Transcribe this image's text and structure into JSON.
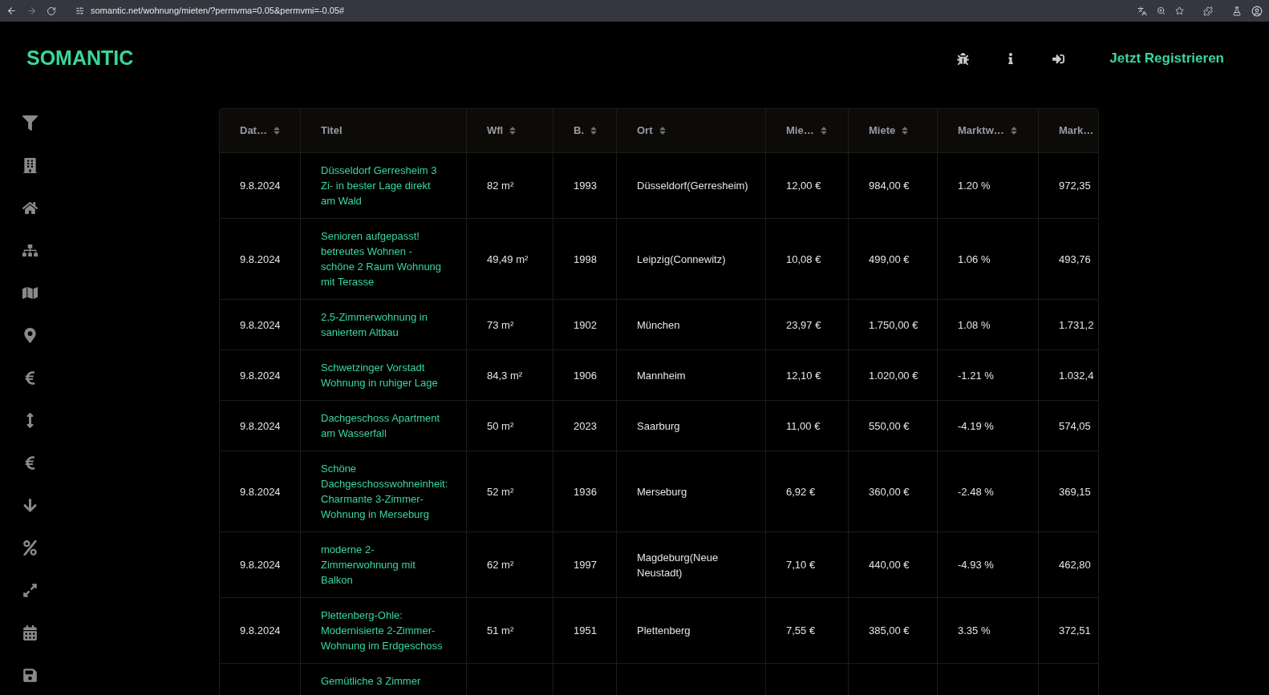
{
  "browser": {
    "url": "somantic.net/wohnung/mieten/?permvma=0.05&permvmi=-0.05#"
  },
  "header": {
    "logo": "SOMANTIC",
    "register": "Jetzt Registrieren"
  },
  "table": {
    "columns": [
      "Dat…",
      "Titel",
      "Wfl",
      "B.",
      "Ort",
      "Mie…",
      "Miete",
      "Marktw…",
      "Mark…"
    ],
    "rows": [
      {
        "date": "9.8.2024",
        "title": "Düsseldorf Gerresheim 3 Zi- in bester Lage direkt am Wald",
        "wfl": "82 m²",
        "year": "1993",
        "ort": "Düsseldorf(Gerresheim)",
        "sqm": "12,00 €",
        "rent": "984,00 €",
        "market": "1.20 %",
        "column_9": "972,35"
      },
      {
        "date": "9.8.2024",
        "title": "Senioren aufgepasst! betreutes Wohnen - schöne 2 Raum Wohnung mit Terasse",
        "wfl": "49,49 m²",
        "year": "1998",
        "ort": "Leipzig(Connewitz)",
        "sqm": "10,08 €",
        "rent": "499,00 €",
        "market": "1.06 %",
        "column_9": "493,76"
      },
      {
        "date": "9.8.2024",
        "title": "2,5-Zimmerwohnung in saniertem Altbau",
        "wfl": "73 m²",
        "year": "1902",
        "ort": "München",
        "sqm": "23,97 €",
        "rent": "1.750,00 €",
        "market": "1.08 %",
        "column_9": "1.731,2"
      },
      {
        "date": "9.8.2024",
        "title": "Schwetzinger Vorstadt Wohnung in ruhiger Lage",
        "wfl": "84,3 m²",
        "year": "1906",
        "ort": "Mannheim",
        "sqm": "12,10 €",
        "rent": "1.020,00 €",
        "market": "-1.21 %",
        "column_9": "1.032,4"
      },
      {
        "date": "9.8.2024",
        "title": "Dachgeschoss Apartment am Wasserfall",
        "wfl": "50 m²",
        "year": "2023",
        "ort": "Saarburg",
        "sqm": "11,00 €",
        "rent": "550,00 €",
        "market": "-4.19 %",
        "column_9": "574,05"
      },
      {
        "date": "9.8.2024",
        "title": "Schöne Dachgeschosswohneinheit: Charmante 3-Zimmer-Wohnung in Merseburg",
        "wfl": "52 m²",
        "year": "1936",
        "ort": "Merseburg",
        "sqm": "6,92 €",
        "rent": "360,00 €",
        "market": "-2.48 %",
        "column_9": "369,15"
      },
      {
        "date": "9.8.2024",
        "title": "moderne 2-Zimmerwohnung mit Balkon",
        "wfl": "62 m²",
        "year": "1997",
        "ort": "Magdeburg(Neue Neustadt)",
        "sqm": "7,10 €",
        "rent": "440,00 €",
        "market": "-4.93 %",
        "column_9": "462,80"
      },
      {
        "date": "9.8.2024",
        "title": "Plettenberg-Ohle: Modernisierte 2-Zimmer-Wohnung im Erdgeschoss",
        "wfl": "51 m²",
        "year": "1951",
        "ort": "Plettenberg",
        "sqm": "7,55 €",
        "rent": "385,00 €",
        "market": "3.35 %",
        "column_9": "372,51"
      },
      {
        "title": "Gemütliche 3 Zimmer"
      }
    ]
  }
}
